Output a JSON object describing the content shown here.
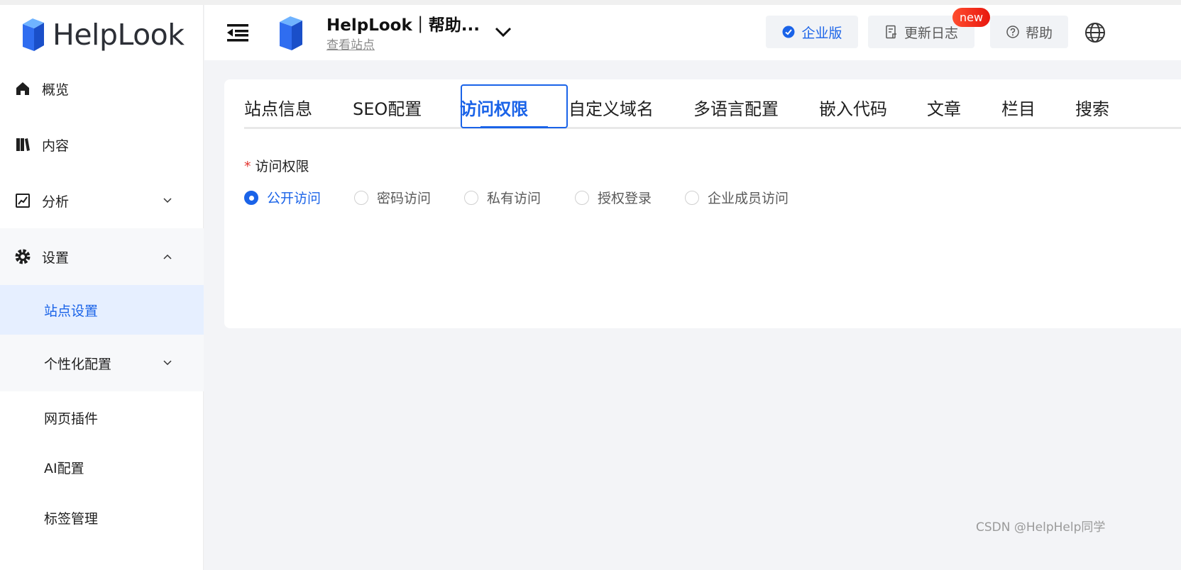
{
  "brand": {
    "name": "HelpLook"
  },
  "sidebar": {
    "items": [
      {
        "label": "概览",
        "icon": "home-icon"
      },
      {
        "label": "内容",
        "icon": "book-icon"
      },
      {
        "label": "分析",
        "icon": "chart-icon"
      },
      {
        "label": "设置",
        "icon": "gear-icon"
      }
    ],
    "sub_items": [
      {
        "label": "站点设置",
        "selected": true
      },
      {
        "label": "个性化配置"
      },
      {
        "label": "网页插件"
      },
      {
        "label": "AI配置"
      },
      {
        "label": "标签管理"
      }
    ]
  },
  "header": {
    "site_title": "HelpLook｜帮助...",
    "site_link": "查看站点",
    "enterprise_label": "企业版",
    "changelog_label": "更新日志",
    "new_badge": "new",
    "help_label": "帮助"
  },
  "tabs": [
    "站点信息",
    "SEO配置",
    "访问权限",
    "自定义域名",
    "多语言配置",
    "嵌入代码",
    "文章",
    "栏目",
    "搜索"
  ],
  "active_tab": "访问权限",
  "form": {
    "required_mark": "*",
    "label": "访问权限",
    "options": [
      "公开访问",
      "密码访问",
      "私有访问",
      "授权登录",
      "企业成员访问"
    ],
    "selected": "公开访问"
  },
  "watermark": "CSDN @HelpHelp同学",
  "colors": {
    "accent": "#1a63e8",
    "badge": "#ff4d2e",
    "sidebar_selected_bg": "#e6efff"
  }
}
